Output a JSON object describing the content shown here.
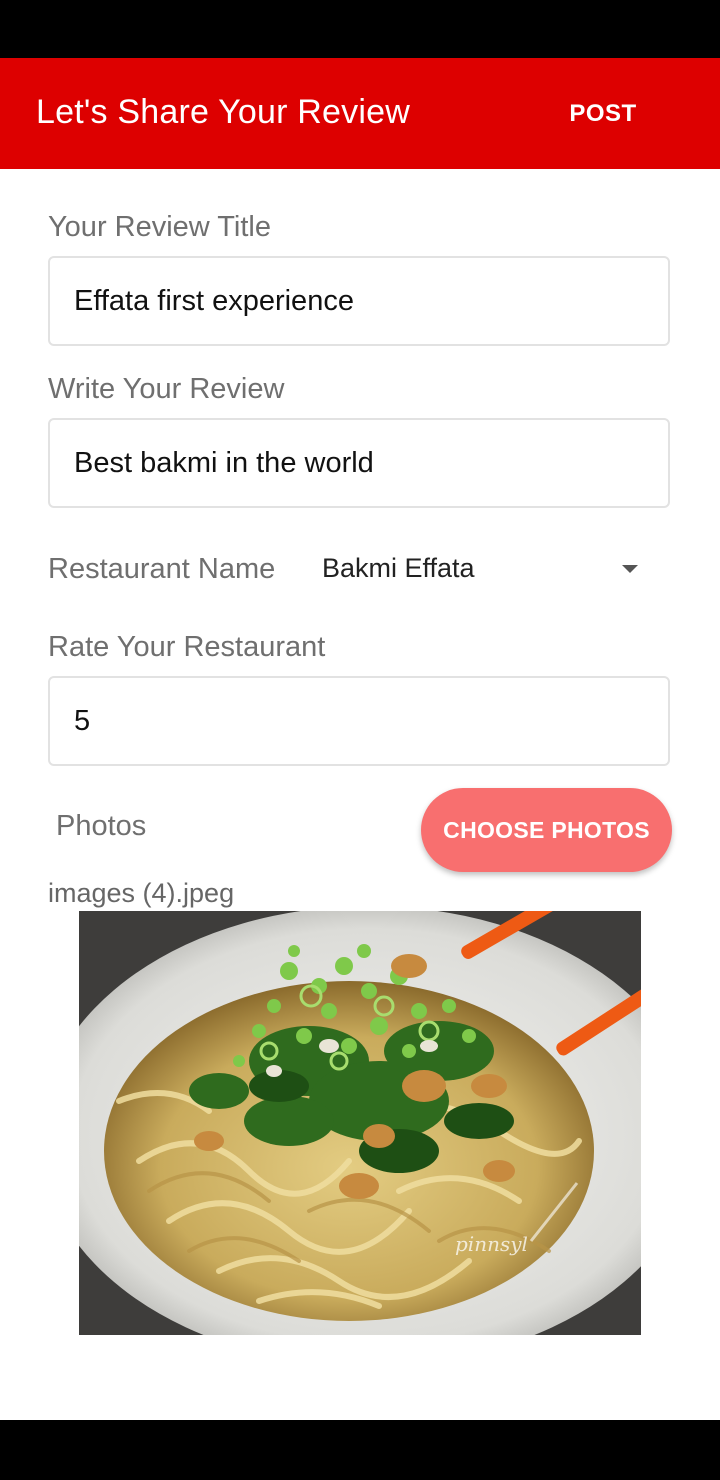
{
  "header": {
    "title": "Let's Share Your Review",
    "post_label": "POST",
    "bg_color": "#dd0000"
  },
  "form": {
    "review_title": {
      "label": "Your Review Title",
      "value": "Effata first experience"
    },
    "review_body": {
      "label": "Write Your Review",
      "value": "Best bakmi in the world"
    },
    "restaurant": {
      "label": "Restaurant Name",
      "value": "Bakmi Effata"
    },
    "rating": {
      "label": "Rate Your Restaurant",
      "value": "5"
    },
    "photos": {
      "label": "Photos",
      "button_label": "CHOOSE PHOTOS",
      "button_color": "#f86f6f",
      "filename": "images (4).jpeg",
      "watermark": "pinnsyl"
    }
  }
}
